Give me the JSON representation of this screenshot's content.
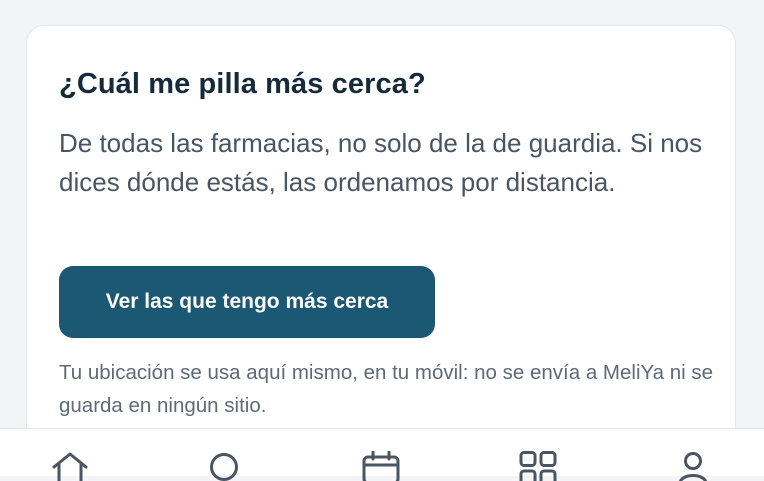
{
  "card": {
    "title": "¿Cuál me pilla más cerca?",
    "description": "De todas las farmacias, no solo de la de guardia. Si nos dices dónde estás, las ordenamos por distancia.",
    "button_label": "Ver las que tengo más cerca",
    "privacy_note": "Tu ubicación se usa aquí mismo, en tu móvil: no se envía a MeliYa ni se guarda en ningún sitio."
  },
  "bottom_nav": {
    "items": [
      {
        "icon": "home-icon"
      },
      {
        "icon": "search-icon"
      },
      {
        "icon": "calendar-icon"
      },
      {
        "icon": "grid-icon"
      },
      {
        "icon": "user-icon"
      }
    ]
  },
  "colors": {
    "accent": "#1b5873",
    "title": "#152b3c",
    "body_text": "#4a5563",
    "muted_text": "#5f6a77",
    "nav_icon": "#4a5563"
  }
}
